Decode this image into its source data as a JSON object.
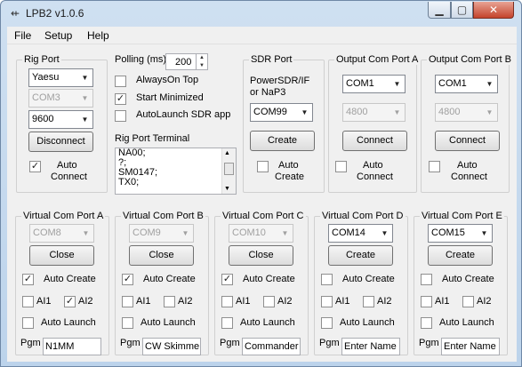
{
  "window": {
    "title": "LPB2 v1.0.6",
    "controls": {
      "minimize": "▁",
      "maximize": "▢",
      "close": "✕"
    }
  },
  "menu": [
    "File",
    "Setup",
    "Help"
  ],
  "rig_port": {
    "label": "Rig Port",
    "radio": "Yaesu",
    "com": "COM3",
    "baud": "9600",
    "button": "Disconnect",
    "auto_label": "Auto",
    "connect_label": "Connect",
    "auto_checked": true
  },
  "polling": {
    "label": "Polling (ms)",
    "value": "200"
  },
  "options": [
    {
      "label": "AlwaysOn Top",
      "checked": false
    },
    {
      "label": "Start Minimized",
      "checked": true
    },
    {
      "label": "AutoLaunch SDR app",
      "checked": false
    }
  ],
  "terminal": {
    "label": "Rig Port Terminal",
    "lines": [
      "NA00;",
      "?;",
      "SM0147;",
      "TX0;"
    ]
  },
  "sdr_port": {
    "label": "SDR Port",
    "desc1": "PowerSDR/IF",
    "desc2": "or NaP3",
    "com": "COM99",
    "button": "Create",
    "auto_label": "Auto",
    "create_label": "Create",
    "auto_checked": false
  },
  "output_ports": [
    {
      "label": "Output Com Port A",
      "com": "COM1",
      "baud": "4800",
      "button": "Connect",
      "auto_label": "Auto",
      "connect_label": "Connect",
      "auto_checked": false
    },
    {
      "label": "Output Com Port B",
      "com": "COM1",
      "baud": "4800",
      "button": "Connect",
      "auto_label": "Auto",
      "connect_label": "Connect",
      "auto_checked": false
    }
  ],
  "vport_labels": {
    "auto_create": "Auto Create",
    "ai1": "AI1",
    "ai2": "AI2",
    "auto_launch": "Auto Launch",
    "pgm": "Pgm"
  },
  "virtual_ports": [
    {
      "label": "Virtual Com Port A",
      "com": "COM8",
      "com_disabled": true,
      "button": "Close",
      "auto_create": true,
      "ai1": false,
      "ai2": true,
      "auto_launch": false,
      "pgm": "N1MM"
    },
    {
      "label": "Virtual Com Port B",
      "com": "COM9",
      "com_disabled": true,
      "button": "Close",
      "auto_create": true,
      "ai1": false,
      "ai2": false,
      "auto_launch": false,
      "pgm": "CW Skimme"
    },
    {
      "label": "Virtual Com Port C",
      "com": "COM10",
      "com_disabled": true,
      "button": "Close",
      "auto_create": true,
      "ai1": false,
      "ai2": false,
      "auto_launch": false,
      "pgm": "Commander"
    },
    {
      "label": "Virtual Com Port D",
      "com": "COM14",
      "com_disabled": false,
      "button": "Create",
      "auto_create": false,
      "ai1": false,
      "ai2": false,
      "auto_launch": false,
      "pgm": "Enter Name"
    },
    {
      "label": "Virtual Com Port E",
      "com": "COM15",
      "com_disabled": false,
      "button": "Create",
      "auto_create": false,
      "ai1": false,
      "ai2": false,
      "auto_launch": false,
      "pgm": "Enter Name"
    }
  ]
}
